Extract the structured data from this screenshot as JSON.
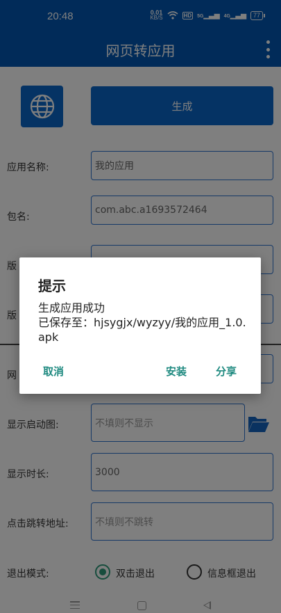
{
  "status_bar": {
    "time": "20:48",
    "net_speed_value": "0.01",
    "net_speed_unit": "KB/S",
    "hd_badge": "HD",
    "signal_1": "5G",
    "signal_2": "4G",
    "battery": "77"
  },
  "app_bar": {
    "title": "网页转应用",
    "more_icon": "more-vert-icon"
  },
  "toolbar": {
    "globe_icon": "globe-icon",
    "generate_label": "生成"
  },
  "form": {
    "app_name": {
      "label": "应用名称:",
      "value": "我的应用"
    },
    "package": {
      "label": "包名:",
      "value": "com.abc.a1693572464"
    },
    "version_name": {
      "label": "版",
      "value": ""
    },
    "version_code": {
      "label": "版",
      "value": ""
    },
    "url": {
      "label": "网",
      "value": ""
    },
    "splash_image": {
      "label": "显示启动图:",
      "placeholder": "不填则不显示",
      "folder_icon": "folder-open-icon"
    },
    "splash_duration": {
      "label": "显示时长:",
      "value": "3000"
    },
    "click_url": {
      "label": "点击跳转地址:",
      "placeholder": "不填则不跳转"
    },
    "exit_mode": {
      "label": "退出模式:",
      "options": [
        "双击退出",
        "信息框退出"
      ],
      "selected": "双击退出"
    }
  },
  "dialog": {
    "title": "提示",
    "message_line1": "生成应用成功",
    "message_line2": "已保存至：hjsygjx/wyzyy/我的应用_1.0.apk",
    "cancel_label": "取消",
    "install_label": "安装",
    "share_label": "分享",
    "accent": "#1f8a80"
  },
  "nav_bar": {
    "menu_icon": "menu-icon",
    "home_icon": "home-icon",
    "back_icon": "back-icon"
  },
  "colors": {
    "primary": "#0257b3",
    "button": "#0a66c8",
    "radio_checked": "#2e9b7b"
  }
}
